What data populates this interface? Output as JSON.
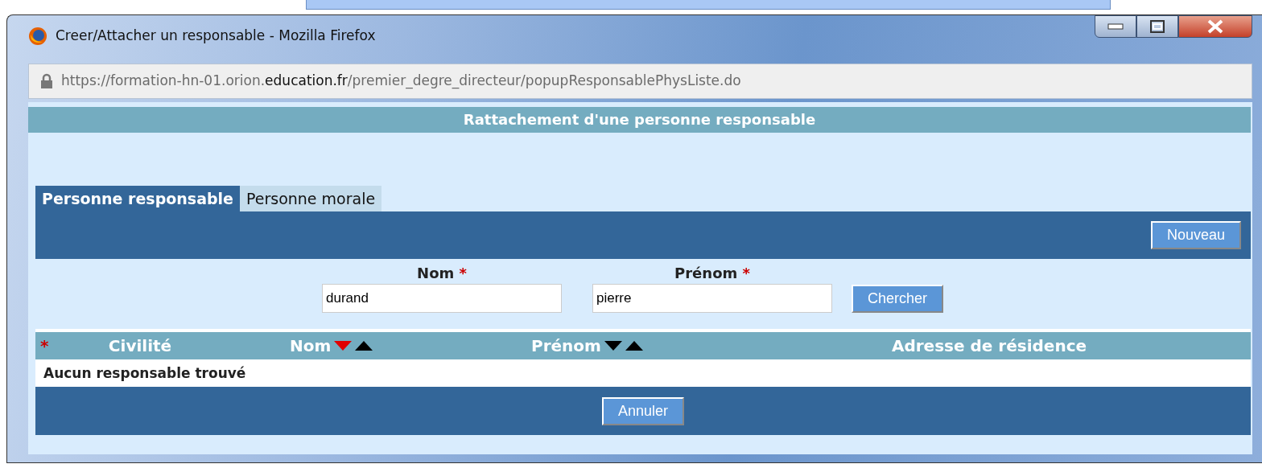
{
  "window": {
    "title": "Creer/Attacher un responsable - Mozilla Firefox"
  },
  "address_bar": {
    "url_prefix": "https://formation-hn-01.orion.",
    "url_domain": "education.fr",
    "url_path": "/premier_degre_directeur/popupResponsablePhysListe.do"
  },
  "page_title": "Rattachement d'une personne responsable",
  "tabs": [
    {
      "label": "Personne responsable",
      "selected": true
    },
    {
      "label": "Personne morale",
      "selected": false
    }
  ],
  "new_button": "Nouveau",
  "search": {
    "fields": [
      {
        "label": "Nom",
        "required_mark": "*",
        "value": "durand"
      },
      {
        "label": "Prénom",
        "required_mark": "*",
        "value": "pierre"
      }
    ],
    "button": "Chercher"
  },
  "table": {
    "columns": [
      {
        "kind": "marker",
        "label": "*"
      },
      {
        "kind": "plain",
        "label": "Civilité"
      },
      {
        "kind": "sortable",
        "label": "Nom",
        "sort": [
          {
            "kind": "down",
            "selected": true
          },
          {
            "kind": "up",
            "selected": false
          }
        ]
      },
      {
        "kind": "sortable",
        "label": "Prénom",
        "sort": [
          {
            "kind": "down",
            "selected": false
          },
          {
            "kind": "up",
            "selected": false
          }
        ]
      },
      {
        "kind": "plain",
        "label": "Adresse de résidence"
      }
    ],
    "empty_message": "Aucun responsable trouvé"
  },
  "cancel_button": "Annuler"
}
